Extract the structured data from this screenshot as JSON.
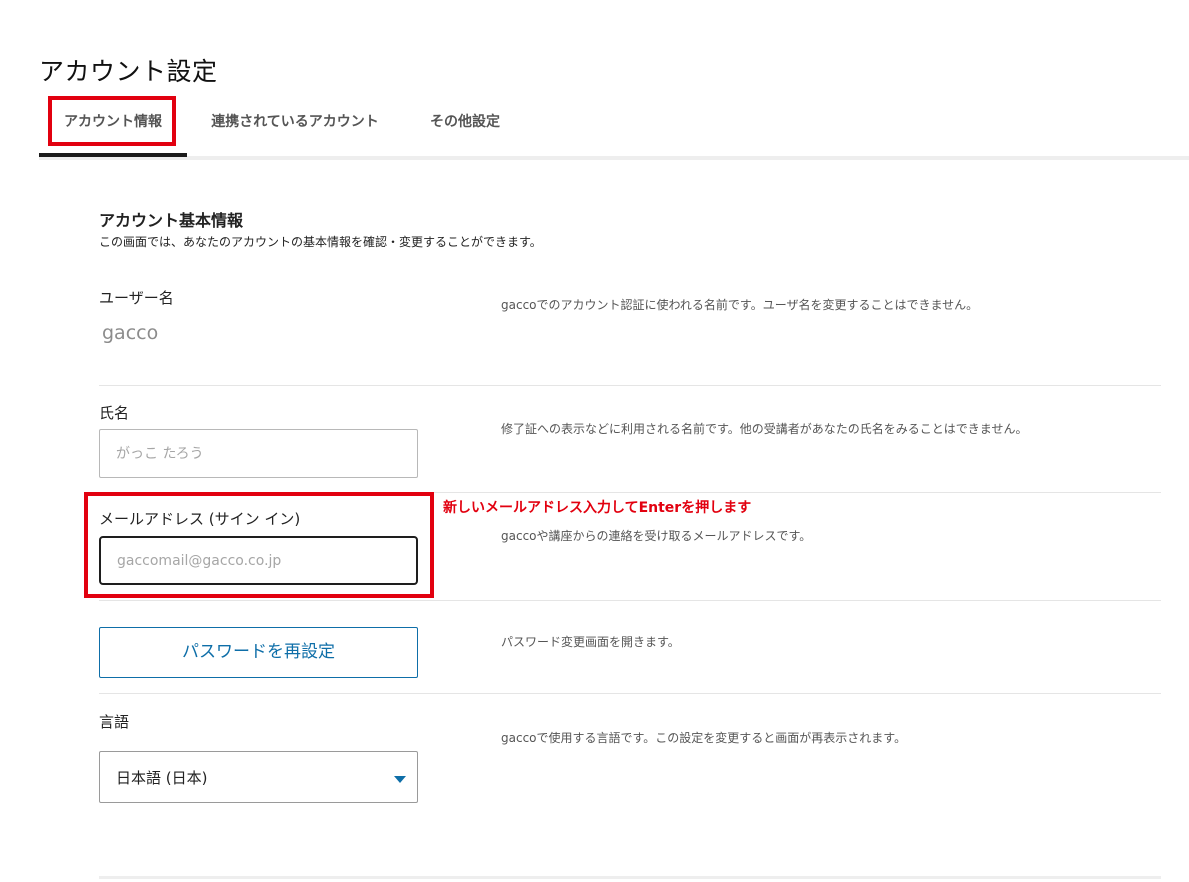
{
  "page": {
    "title": "アカウント設定"
  },
  "tabs": [
    {
      "label": "アカウント情報",
      "active": true
    },
    {
      "label": "連携されているアカウント",
      "active": false
    },
    {
      "label": "その他設定",
      "active": false
    }
  ],
  "section": {
    "title": "アカウント基本情報",
    "description": "この画面では、あなたのアカウントの基本情報を確認・変更することができます。"
  },
  "fields": {
    "username": {
      "label": "ユーザー名",
      "value": "gacco",
      "help": "gaccoでのアカウント認証に使われる名前です。ユーザ名を変更することはできません。"
    },
    "full_name": {
      "label": "氏名",
      "placeholder": "がっこ たろう",
      "help": "修了証への表示などに利用される名前です。他の受講者があなたの氏名をみることはできません。"
    },
    "email": {
      "label": "メールアドレス (サイン イン)",
      "placeholder": "gaccomail@gacco.co.jp",
      "help": "gaccoや講座からの連絡を受け取るメールアドレスです。"
    },
    "password": {
      "button_label": "パスワードを再設定",
      "help": "パスワード変更画面を開きます。"
    },
    "language": {
      "label": "言語",
      "selected": "日本語 (日本)",
      "help": "gaccoで使用する言語です。この設定を変更すると画面が再表示されます。"
    }
  },
  "annotation": {
    "text": "新しいメールアドレス入力してEnterを押します",
    "color": "#e2000f"
  },
  "colors": {
    "accent": "#0e6ea8",
    "highlight": "#e2000f"
  }
}
